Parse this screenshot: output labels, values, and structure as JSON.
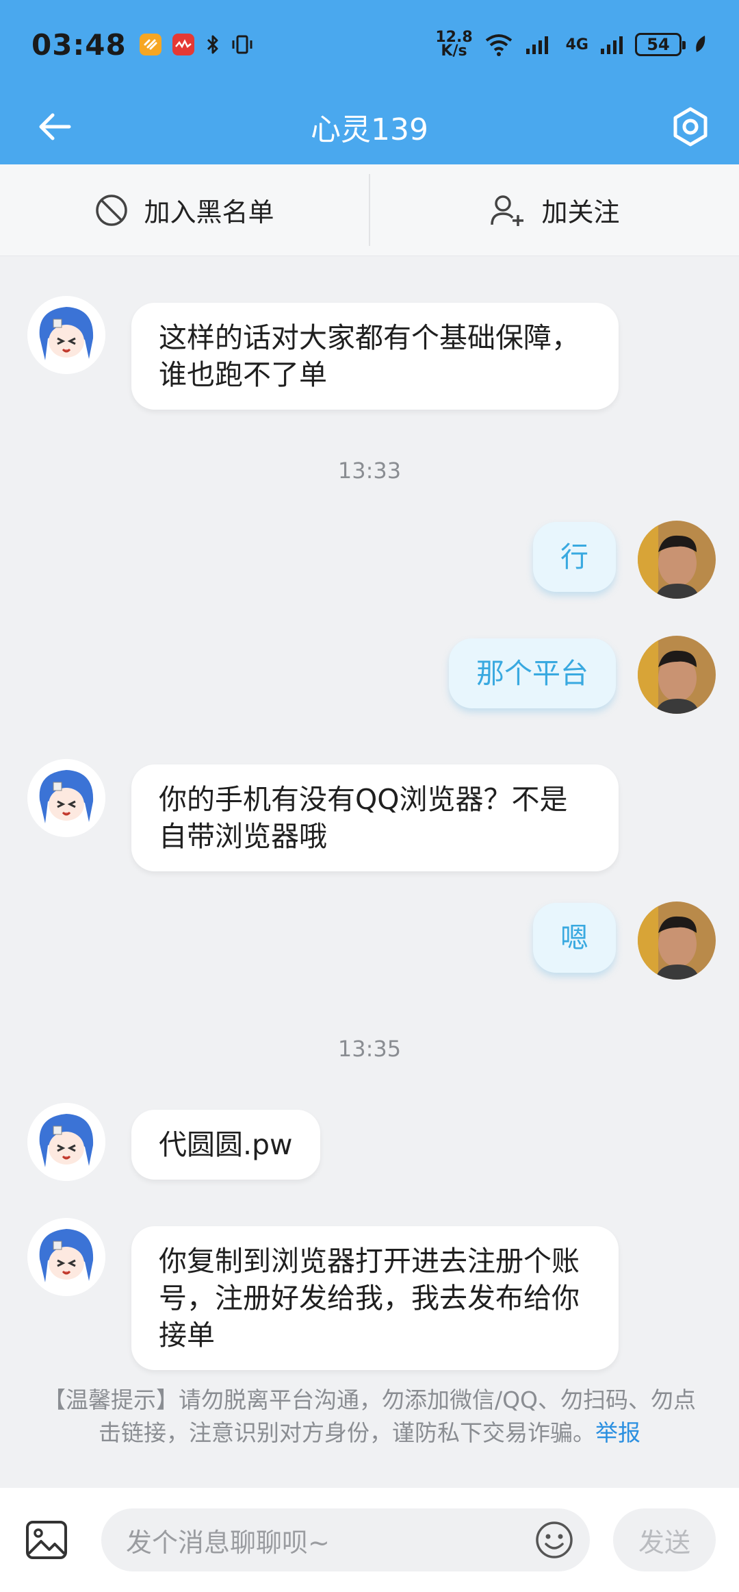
{
  "status_bar": {
    "time": "03:48",
    "net_speed_value": "12.8",
    "net_speed_unit": "K/s",
    "network_type": "4G",
    "battery": "54"
  },
  "header": {
    "title": "心灵139"
  },
  "actions": {
    "blacklist_label": "加入黑名单",
    "follow_label": "加关注"
  },
  "messages": [
    {
      "side": "in",
      "text": "这样的话对大家都有个基础保障，谁也跑不了单"
    },
    {
      "side": "time",
      "text": "13:33"
    },
    {
      "side": "out",
      "text": "行"
    },
    {
      "side": "out",
      "text": "那个平台"
    },
    {
      "side": "in",
      "text": "你的手机有没有QQ浏览器？不是自带浏览器哦"
    },
    {
      "side": "out",
      "text": "嗯"
    },
    {
      "side": "time",
      "text": "13:35"
    },
    {
      "side": "in",
      "text": "代圆圆.pw"
    },
    {
      "side": "in",
      "text": "你复制到浏览器打开进去注册个账号，注册好发给我，我去发布给你接单"
    }
  ],
  "notice": {
    "text": "【温馨提示】请勿脱离平台沟通，勿添加微信/QQ、勿扫码、勿点击链接，注意识别对方身份，谨防私下交易诈骗。",
    "report_label": "举报"
  },
  "input": {
    "placeholder": "发个消息聊聊呗~",
    "send_label": "发送"
  },
  "colors": {
    "header_bg": "#4aa8ee",
    "outgoing_bubble_bg": "#e8f6fd",
    "outgoing_text": "#39a9e0",
    "link": "#2a8fe0"
  }
}
